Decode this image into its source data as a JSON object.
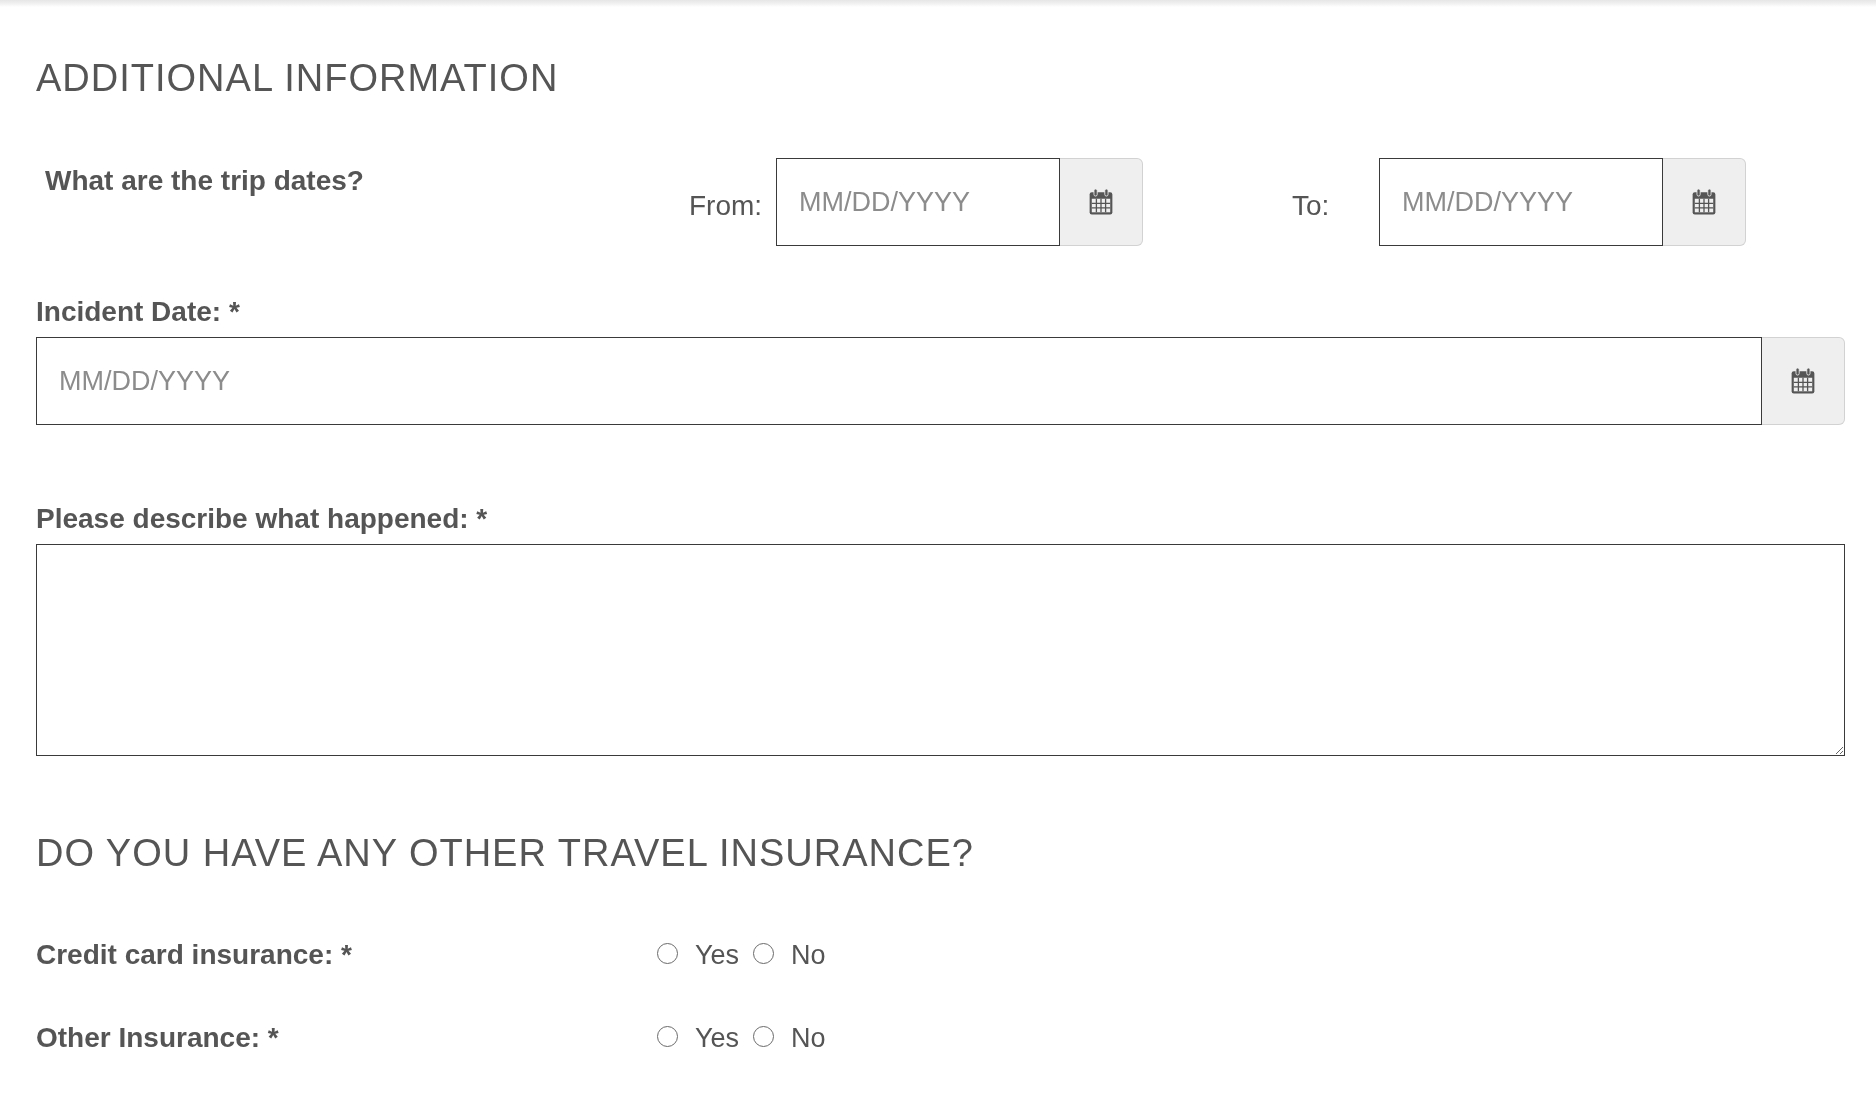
{
  "additional_information": {
    "title": "ADDITIONAL INFORMATION",
    "trip_dates": {
      "question": "What are the trip dates?",
      "fields": [
        {
          "label": "From:",
          "placeholder": "MM/DD/YYYY"
        },
        {
          "label": "To:",
          "placeholder": "MM/DD/YYYY"
        }
      ]
    },
    "incident_date": {
      "label": "Incident Date: *",
      "placeholder": "MM/DD/YYYY"
    },
    "description": {
      "label": "Please describe what happened: *"
    }
  },
  "other_insurance": {
    "title": "DO YOU HAVE ANY OTHER TRAVEL INSURANCE?",
    "questions": [
      {
        "label": "Credit card insurance: *",
        "options": [
          {
            "label": "Yes",
            "selected": false
          },
          {
            "label": "No",
            "selected": false
          }
        ]
      },
      {
        "label": "Other Insurance: *",
        "options": [
          {
            "label": "Yes",
            "selected": false
          },
          {
            "label": "No",
            "selected": false
          }
        ]
      }
    ]
  }
}
